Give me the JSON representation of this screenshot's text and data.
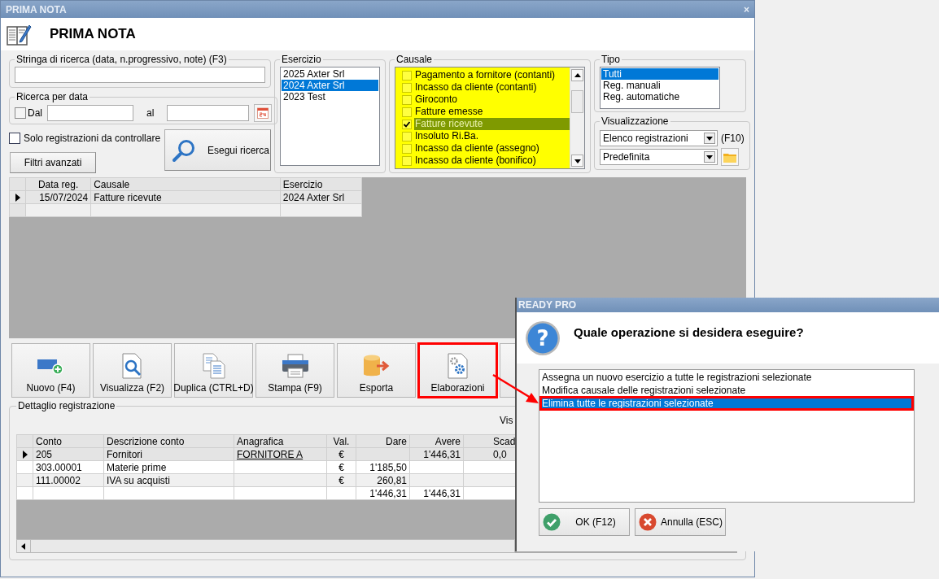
{
  "window": {
    "title": "PRIMA NOTA",
    "close": "×"
  },
  "header": {
    "title": "PRIMA NOTA"
  },
  "search": {
    "label": "Stringa di ricerca (data, n.progressivo, note) (F3)"
  },
  "date_search": {
    "label": "Ricerca per data",
    "from_label": "Dal",
    "from_checked": false,
    "to_label": "al"
  },
  "only_to_check": {
    "label": "Solo registrazioni da controllare",
    "checked": false
  },
  "advanced_filters_button": "Filtri avanzati",
  "run_search_button": "Esegui ricerca",
  "esercizio": {
    "label": "Esercizio",
    "items": [
      {
        "label": "2025 Axter Srl",
        "selected": false
      },
      {
        "label": "2024 Axter Srl",
        "selected": true
      },
      {
        "label": "2023 Test",
        "selected": false
      }
    ]
  },
  "causale": {
    "label": "Causale",
    "items": [
      {
        "label": "Pagamento a fornitore (contanti)",
        "checked": false,
        "selected": false
      },
      {
        "label": "Incasso da cliente (contanti)",
        "checked": false,
        "selected": false
      },
      {
        "label": "Giroconto",
        "checked": false,
        "selected": false
      },
      {
        "label": "Fatture emesse",
        "checked": false,
        "selected": false
      },
      {
        "label": "Fatture ricevute",
        "checked": true,
        "selected": true
      },
      {
        "label": "Insoluto Ri.Ba.",
        "checked": false,
        "selected": false
      },
      {
        "label": "Incasso da cliente (assegno)",
        "checked": false,
        "selected": false
      },
      {
        "label": "Incasso da cliente (bonifico)",
        "checked": false,
        "selected": false
      }
    ]
  },
  "tipo": {
    "label": "Tipo",
    "items": [
      {
        "label": "Tutti",
        "selected": true
      },
      {
        "label": "Reg. manuali",
        "selected": false
      },
      {
        "label": "Reg. automatiche",
        "selected": false
      }
    ]
  },
  "visualizzazione": {
    "label": "Visualizzazione",
    "view": "Elenco registrazioni",
    "shortcut": "(F10)",
    "layout": "Predefinita"
  },
  "registrations": {
    "columns": [
      "Data reg.",
      "Causale",
      "Esercizio"
    ],
    "rows": [
      {
        "cells": [
          "15/07/2024",
          "Fatture ricevute",
          "2024 Axter Srl"
        ],
        "current": true
      }
    ]
  },
  "toolbar": [
    {
      "label": "Nuovo (F4)",
      "highlighted": false
    },
    {
      "label": "Visualizza (F2)",
      "highlighted": false
    },
    {
      "label": "Duplica (CTRL+D)",
      "highlighted": false
    },
    {
      "label": "Stampa (F9)",
      "highlighted": false
    },
    {
      "label": "Esporta",
      "highlighted": false
    },
    {
      "label": "Elaborazioni",
      "highlighted": true
    }
  ],
  "detail": {
    "label": "Dettaglio registrazione",
    "side_text": "Vis",
    "columns": [
      "Conto",
      "Descrizione conto",
      "Anagrafica",
      "Val.",
      "Dare",
      "Avere",
      "Scad"
    ],
    "rows": [
      {
        "cells": [
          "205",
          "Fornitori",
          "FORNITORE A",
          "€",
          null,
          "1'446,31",
          "0,0"
        ],
        "current": true
      },
      {
        "cells": [
          "303.00001",
          "Materie prime",
          null,
          "€",
          "1'185,50",
          null,
          null
        ],
        "current": false
      },
      {
        "cells": [
          "111.00002",
          "IVA su acquisti",
          null,
          "€",
          "260,81",
          null,
          null
        ],
        "current": false
      },
      {
        "cells": [
          null,
          null,
          null,
          null,
          "1'446,31",
          "1'446,31",
          null
        ],
        "current": false
      }
    ]
  },
  "dialog": {
    "title": "READY PRO",
    "icon_glyph": "?",
    "question": "Quale operazione si desidera eseguire?",
    "options": [
      {
        "label": "Assegna un nuovo esercizio a tutte le registrazioni selezionate",
        "selected": false,
        "highlighted": false
      },
      {
        "label": "Modifica causale delle registrazioni selezionate",
        "selected": false,
        "highlighted": false
      },
      {
        "label": "Elimina tutte le registrazioni selezionate",
        "selected": true,
        "highlighted": true
      }
    ],
    "buttons": [
      {
        "label": "OK (F12)",
        "kind": "ok"
      },
      {
        "label": "Annulla (ESC)",
        "kind": "cancel"
      }
    ]
  }
}
